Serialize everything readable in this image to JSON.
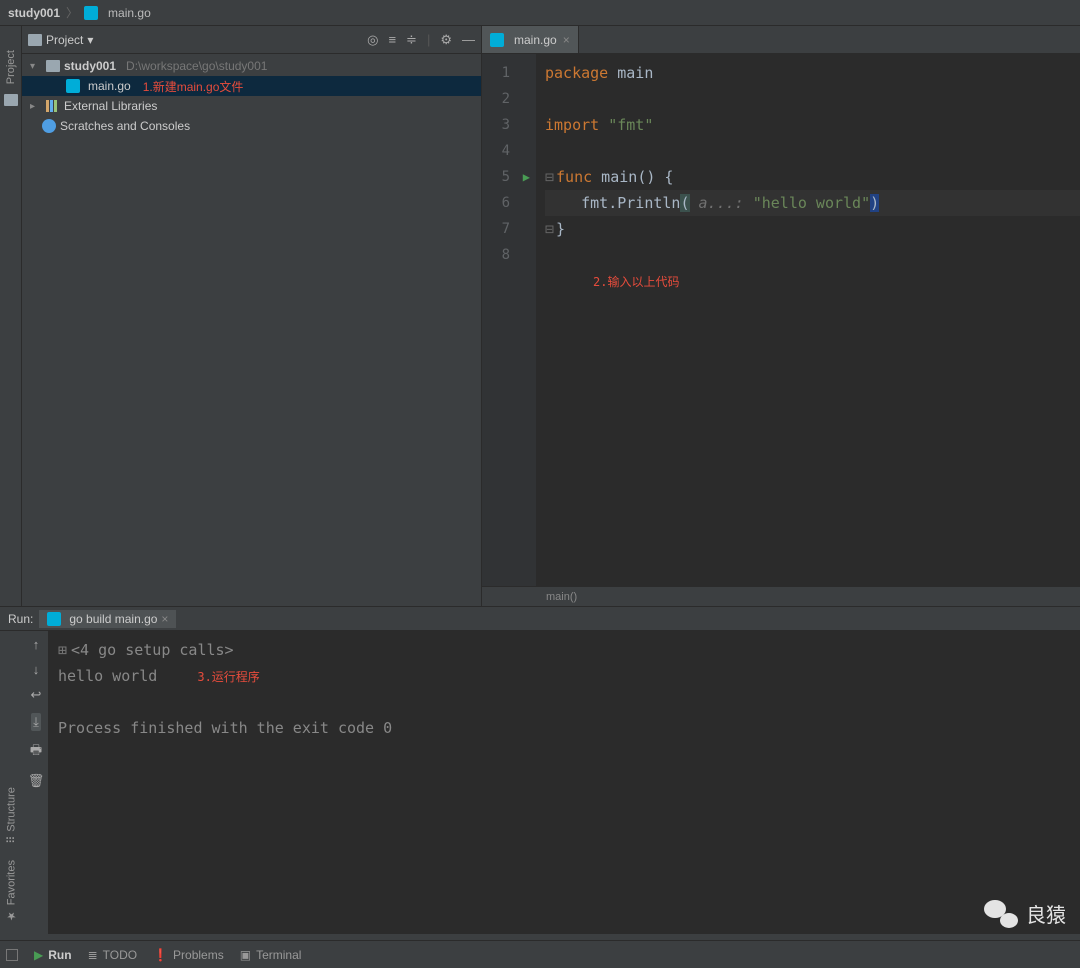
{
  "breadcrumb": {
    "project": "study001",
    "file": "main.go"
  },
  "projectPanel": {
    "title": "Project",
    "root": {
      "name": "study001",
      "path": "D:\\workspace\\go\\study001"
    },
    "mainFile": "main.go",
    "annot1": "1.新建main.go文件",
    "externalLibs": "External Libraries",
    "scratches": "Scratches and Consoles"
  },
  "tab": {
    "name": "main.go"
  },
  "code": {
    "l1": {
      "kw": "package",
      "id": " main"
    },
    "l3": {
      "kw": "import",
      "str": " \"fmt\""
    },
    "l5": {
      "kw": "func",
      "id": " main",
      "rest": "() {"
    },
    "l6": {
      "pre": "   fmt.Println",
      "open": "(",
      "hint": " a...: ",
      "str": "\"hello world\"",
      "close": ")"
    },
    "l7": "}",
    "annot2": "2.输入以上代码"
  },
  "gutterLines": [
    "1",
    "2",
    "3",
    "4",
    "5",
    "6",
    "7",
    "8"
  ],
  "breadcrumbFn": "main()",
  "run": {
    "label": "Run:",
    "tab": "go build main.go",
    "lines": {
      "setup": "<4 go setup calls>",
      "out": "hello world",
      "exit": "Process finished with the exit code 0"
    },
    "annot3": "3.运行程序"
  },
  "sideTabs": {
    "project": "Project",
    "structure": "Structure",
    "favorites": "Favorites"
  },
  "statusBar": {
    "run": "Run",
    "todo": "TODO",
    "problems": "Problems",
    "terminal": "Terminal"
  },
  "watermark": "良猿"
}
